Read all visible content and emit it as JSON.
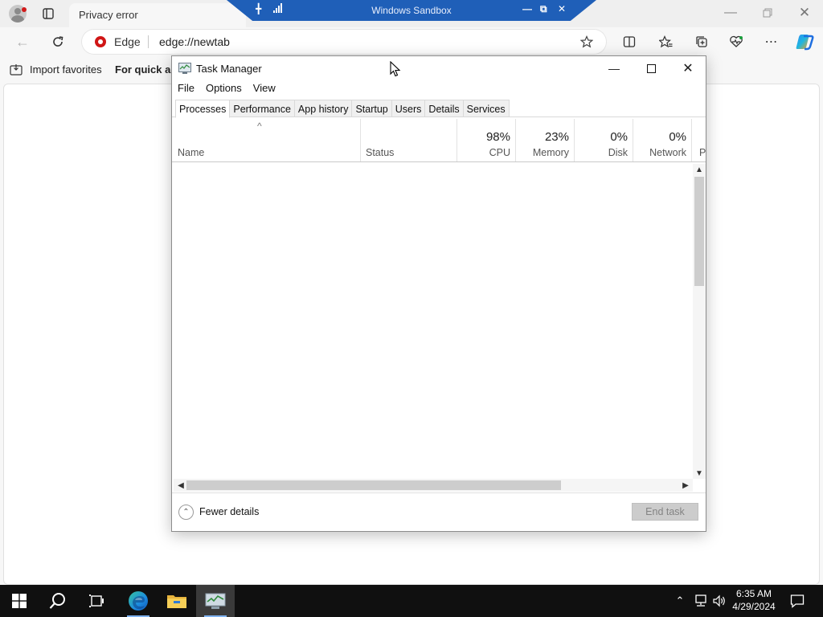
{
  "browser": {
    "tab_title": "Privacy error",
    "site_label": "Edge",
    "url": "edge://newtab",
    "favorites": {
      "import_label": "Import favorites",
      "quick_access_label": "For quick acc"
    }
  },
  "sandbox": {
    "title": "Windows Sandbox"
  },
  "task_manager": {
    "title": "Task Manager",
    "menu": [
      "File",
      "Options",
      "View"
    ],
    "tabs": [
      "Processes",
      "Performance",
      "App history",
      "Startup",
      "Users",
      "Details",
      "Services"
    ],
    "active_tab": "Processes",
    "columns": {
      "name": "Name",
      "status": "Status",
      "cpu": {
        "label": "CPU",
        "value": "98%"
      },
      "memory": {
        "label": "Memory",
        "value": "23%"
      },
      "disk": {
        "label": "Disk",
        "value": "0%"
      },
      "network": {
        "label": "Network",
        "value": "0%"
      },
      "power_partial": "P"
    },
    "sort_indicator": "^",
    "fewer_details_label": "Fewer details",
    "end_task_label": "End task"
  },
  "taskbar": {
    "time": "6:35 AM",
    "date": "4/29/2024",
    "apps": [
      "start-icon",
      "search-icon",
      "task-view-icon",
      "edge-icon",
      "file-explorer-icon",
      "task-manager-icon"
    ]
  },
  "colors": {
    "sandbox_bar": "#1f5fb8",
    "taskbar": "#101010",
    "edge_logo": "#d01616"
  }
}
